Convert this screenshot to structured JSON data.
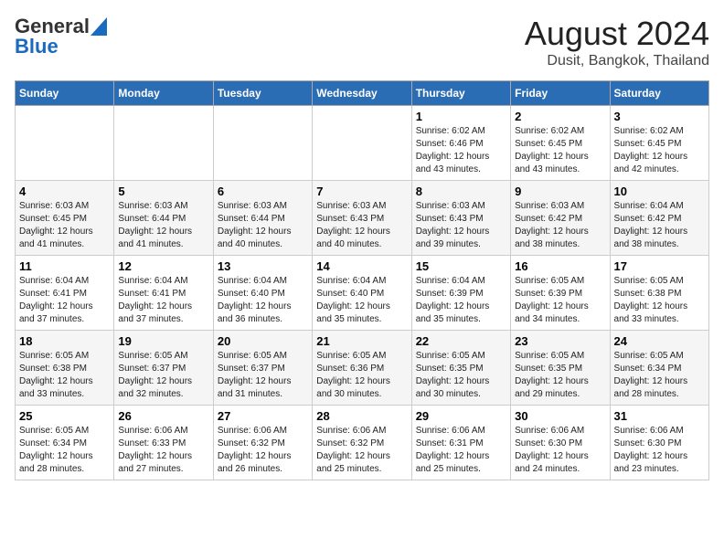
{
  "header": {
    "logo_line1": "General",
    "logo_line2": "Blue",
    "month_title": "August 2024",
    "location": "Dusit, Bangkok, Thailand"
  },
  "weekdays": [
    "Sunday",
    "Monday",
    "Tuesday",
    "Wednesday",
    "Thursday",
    "Friday",
    "Saturday"
  ],
  "weeks": [
    [
      {
        "day": "",
        "info": ""
      },
      {
        "day": "",
        "info": ""
      },
      {
        "day": "",
        "info": ""
      },
      {
        "day": "",
        "info": ""
      },
      {
        "day": "1",
        "info": "Sunrise: 6:02 AM\nSunset: 6:46 PM\nDaylight: 12 hours\nand 43 minutes."
      },
      {
        "day": "2",
        "info": "Sunrise: 6:02 AM\nSunset: 6:45 PM\nDaylight: 12 hours\nand 43 minutes."
      },
      {
        "day": "3",
        "info": "Sunrise: 6:02 AM\nSunset: 6:45 PM\nDaylight: 12 hours\nand 42 minutes."
      }
    ],
    [
      {
        "day": "4",
        "info": "Sunrise: 6:03 AM\nSunset: 6:45 PM\nDaylight: 12 hours\nand 41 minutes."
      },
      {
        "day": "5",
        "info": "Sunrise: 6:03 AM\nSunset: 6:44 PM\nDaylight: 12 hours\nand 41 minutes."
      },
      {
        "day": "6",
        "info": "Sunrise: 6:03 AM\nSunset: 6:44 PM\nDaylight: 12 hours\nand 40 minutes."
      },
      {
        "day": "7",
        "info": "Sunrise: 6:03 AM\nSunset: 6:43 PM\nDaylight: 12 hours\nand 40 minutes."
      },
      {
        "day": "8",
        "info": "Sunrise: 6:03 AM\nSunset: 6:43 PM\nDaylight: 12 hours\nand 39 minutes."
      },
      {
        "day": "9",
        "info": "Sunrise: 6:03 AM\nSunset: 6:42 PM\nDaylight: 12 hours\nand 38 minutes."
      },
      {
        "day": "10",
        "info": "Sunrise: 6:04 AM\nSunset: 6:42 PM\nDaylight: 12 hours\nand 38 minutes."
      }
    ],
    [
      {
        "day": "11",
        "info": "Sunrise: 6:04 AM\nSunset: 6:41 PM\nDaylight: 12 hours\nand 37 minutes."
      },
      {
        "day": "12",
        "info": "Sunrise: 6:04 AM\nSunset: 6:41 PM\nDaylight: 12 hours\nand 37 minutes."
      },
      {
        "day": "13",
        "info": "Sunrise: 6:04 AM\nSunset: 6:40 PM\nDaylight: 12 hours\nand 36 minutes."
      },
      {
        "day": "14",
        "info": "Sunrise: 6:04 AM\nSunset: 6:40 PM\nDaylight: 12 hours\nand 35 minutes."
      },
      {
        "day": "15",
        "info": "Sunrise: 6:04 AM\nSunset: 6:39 PM\nDaylight: 12 hours\nand 35 minutes."
      },
      {
        "day": "16",
        "info": "Sunrise: 6:05 AM\nSunset: 6:39 PM\nDaylight: 12 hours\nand 34 minutes."
      },
      {
        "day": "17",
        "info": "Sunrise: 6:05 AM\nSunset: 6:38 PM\nDaylight: 12 hours\nand 33 minutes."
      }
    ],
    [
      {
        "day": "18",
        "info": "Sunrise: 6:05 AM\nSunset: 6:38 PM\nDaylight: 12 hours\nand 33 minutes."
      },
      {
        "day": "19",
        "info": "Sunrise: 6:05 AM\nSunset: 6:37 PM\nDaylight: 12 hours\nand 32 minutes."
      },
      {
        "day": "20",
        "info": "Sunrise: 6:05 AM\nSunset: 6:37 PM\nDaylight: 12 hours\nand 31 minutes."
      },
      {
        "day": "21",
        "info": "Sunrise: 6:05 AM\nSunset: 6:36 PM\nDaylight: 12 hours\nand 30 minutes."
      },
      {
        "day": "22",
        "info": "Sunrise: 6:05 AM\nSunset: 6:35 PM\nDaylight: 12 hours\nand 30 minutes."
      },
      {
        "day": "23",
        "info": "Sunrise: 6:05 AM\nSunset: 6:35 PM\nDaylight: 12 hours\nand 29 minutes."
      },
      {
        "day": "24",
        "info": "Sunrise: 6:05 AM\nSunset: 6:34 PM\nDaylight: 12 hours\nand 28 minutes."
      }
    ],
    [
      {
        "day": "25",
        "info": "Sunrise: 6:05 AM\nSunset: 6:34 PM\nDaylight: 12 hours\nand 28 minutes."
      },
      {
        "day": "26",
        "info": "Sunrise: 6:06 AM\nSunset: 6:33 PM\nDaylight: 12 hours\nand 27 minutes."
      },
      {
        "day": "27",
        "info": "Sunrise: 6:06 AM\nSunset: 6:32 PM\nDaylight: 12 hours\nand 26 minutes."
      },
      {
        "day": "28",
        "info": "Sunrise: 6:06 AM\nSunset: 6:32 PM\nDaylight: 12 hours\nand 25 minutes."
      },
      {
        "day": "29",
        "info": "Sunrise: 6:06 AM\nSunset: 6:31 PM\nDaylight: 12 hours\nand 25 minutes."
      },
      {
        "day": "30",
        "info": "Sunrise: 6:06 AM\nSunset: 6:30 PM\nDaylight: 12 hours\nand 24 minutes."
      },
      {
        "day": "31",
        "info": "Sunrise: 6:06 AM\nSunset: 6:30 PM\nDaylight: 12 hours\nand 23 minutes."
      }
    ]
  ]
}
